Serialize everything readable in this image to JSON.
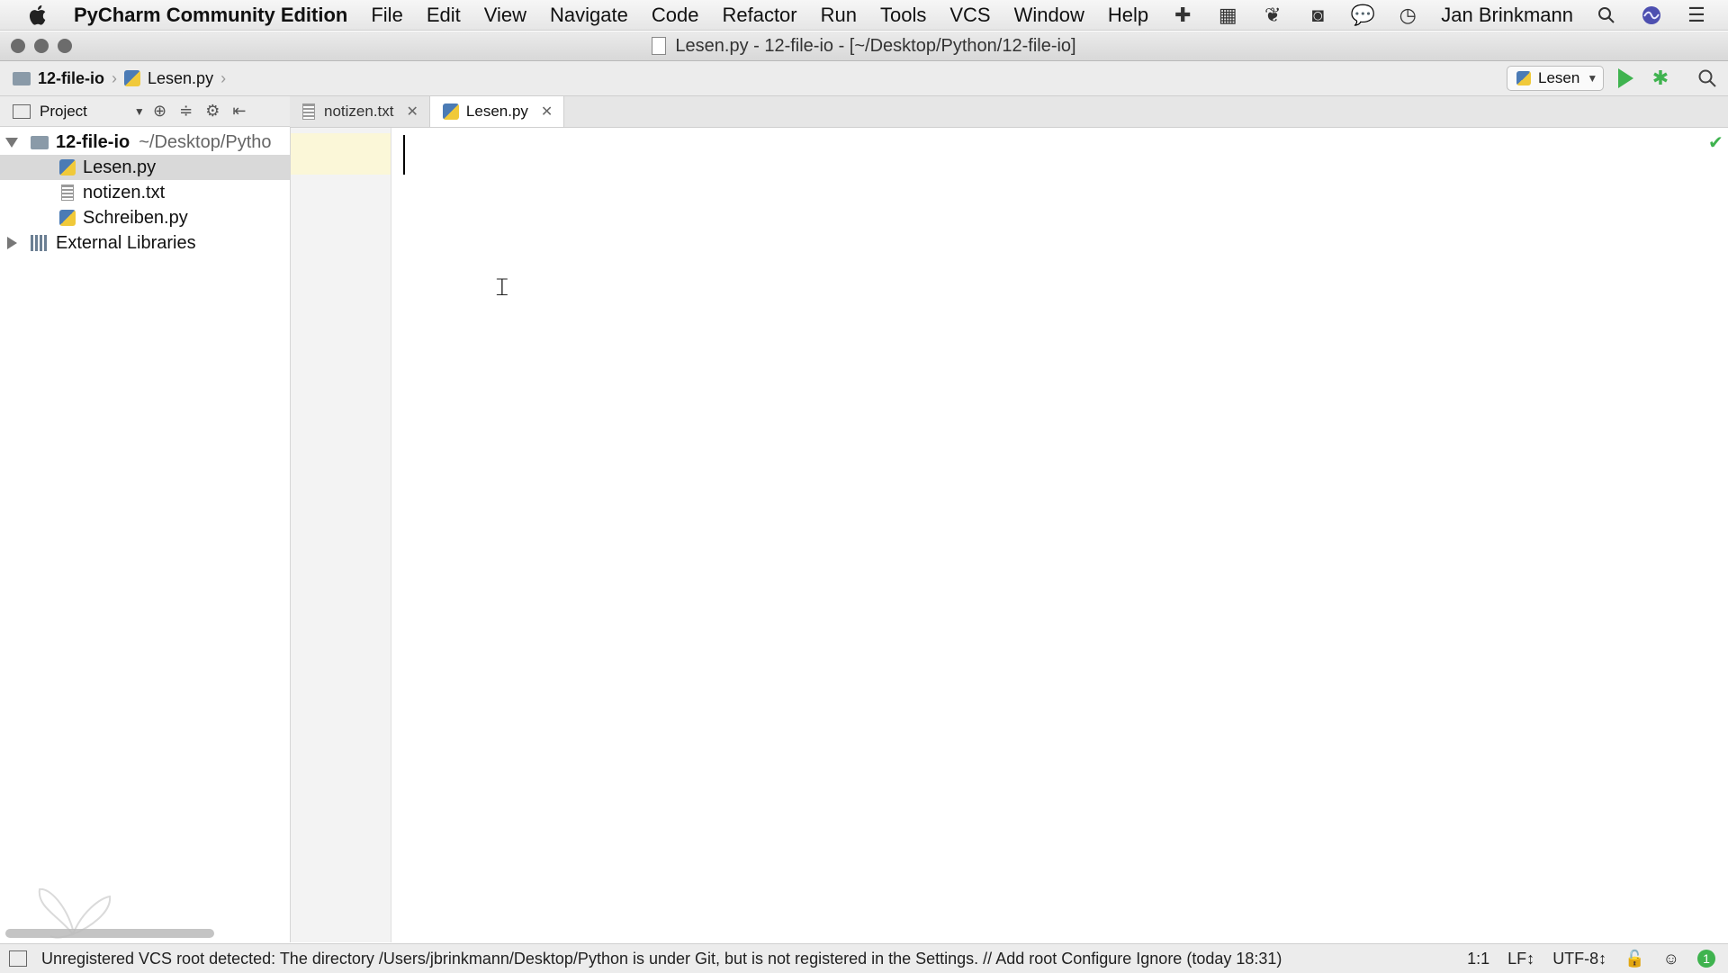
{
  "menubar": {
    "app_name": "PyCharm Community Edition",
    "items": [
      "File",
      "Edit",
      "View",
      "Navigate",
      "Code",
      "Refactor",
      "Run",
      "Tools",
      "VCS",
      "Window",
      "Help"
    ],
    "user": "Jan Brinkmann"
  },
  "window": {
    "title": "Lesen.py - 12-file-io - [~/Desktop/Python/12-file-io]"
  },
  "navbar": {
    "crumbs": [
      "12-file-io",
      "Lesen.py"
    ],
    "run_config": "Lesen"
  },
  "project_panel": {
    "label": "Project"
  },
  "tabs": [
    {
      "label": "notizen.txt",
      "active": false
    },
    {
      "label": "Lesen.py",
      "active": true
    }
  ],
  "tree": {
    "root_name": "12-file-io",
    "root_path": "~/Desktop/Pytho",
    "files": [
      "Lesen.py",
      "notizen.txt",
      "Schreiben.py"
    ],
    "libraries": "External Libraries"
  },
  "statusbar": {
    "message": "Unregistered VCS root detected: The directory /Users/jbrinkmann/Desktop/Python is under Git, but is not registered in the Settings. // Add root  Configure  Ignore (today 18:31)",
    "position": "1:1",
    "line_sep": "LF↕",
    "encoding": "UTF-8↕",
    "notifications": "1"
  },
  "icons": {
    "apple": "apple-icon",
    "run": "run-icon",
    "debug": "debug-icon",
    "search": "search-icon"
  },
  "colors": {
    "run_green": "#3fb34f",
    "selection": "#d9d9d9"
  }
}
